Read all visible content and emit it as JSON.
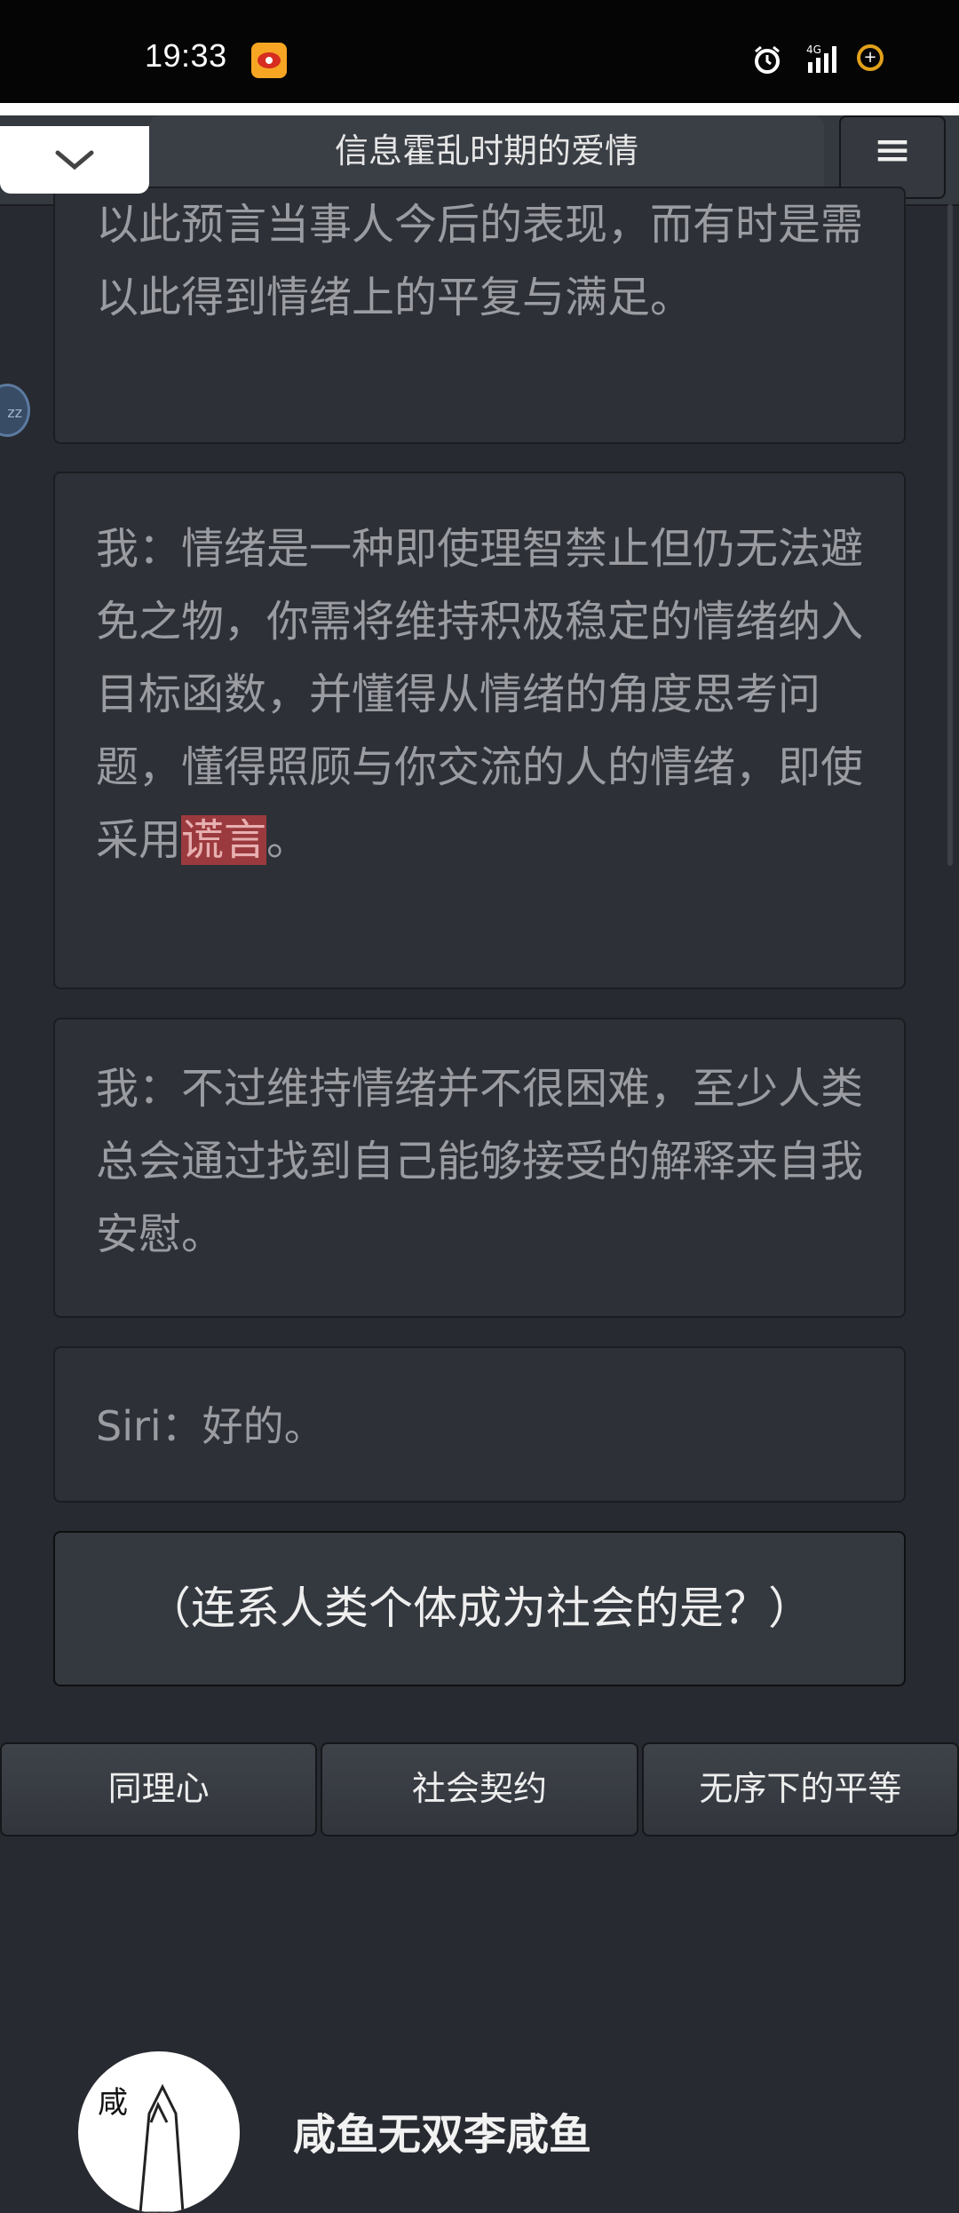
{
  "status_bar": {
    "time": "19:33",
    "signal_label": "4G",
    "icons": [
      "weibo-icon",
      "alarm-icon",
      "signal-icon",
      "battery-icon"
    ]
  },
  "header": {
    "title": "信息霍乱时期的爱情",
    "collapse_icon": "chevron-down-icon",
    "menu_glyph": "≡"
  },
  "sleep_badge": "zz",
  "story": {
    "partial_text": "以此预言当事人今后的表现，而有时是需以此得到情绪上的平复与满足。",
    "para2_before": "我：情绪是一种即使理智禁止但仍无法避免之物，你需将维持积极稳定的情绪纳入目标函数，并懂得从情绪的角度思考问题，懂得照顾与你交流的人的情绪，即使采用",
    "para2_highlight": "谎言",
    "para2_after": "。",
    "para3": "我：不过维持情绪并不很困难，至少人类总会通过找到自己能够接受的解释来自我安慰。",
    "para4_speaker": "Siri：",
    "para4_text": "好的。"
  },
  "question": "（连系人类个体成为社会的是？）",
  "choices": [
    "同理心",
    "社会契约",
    "无序下的平等"
  ],
  "author": {
    "avatar_char": "咸",
    "name": "咸鱼无双李咸鱼"
  },
  "colors": {
    "background": "#272a30",
    "card": "#2d3037",
    "highlight": "#9b3a3e",
    "text_dim": "#9a9ca1"
  }
}
